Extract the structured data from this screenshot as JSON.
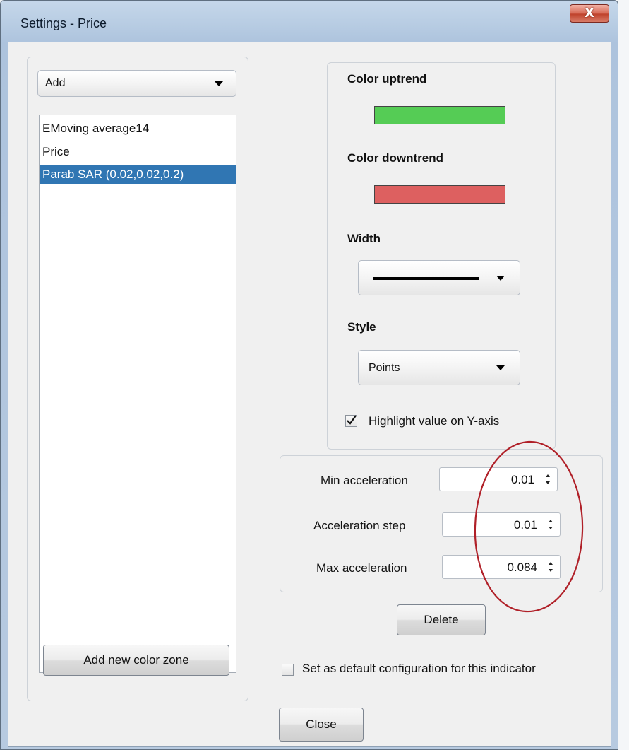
{
  "window": {
    "title": "Settings - Price",
    "close_glyph": "X"
  },
  "left_panel": {
    "add_dropdown": {
      "value": "Add"
    },
    "indicators": [
      {
        "label": "EMoving average14",
        "selected": false
      },
      {
        "label": "Price",
        "selected": false
      },
      {
        "label": "Parab SAR (0.02,0.02,0.2)",
        "selected": true
      }
    ],
    "add_zone_button": "Add new color zone"
  },
  "style_panel": {
    "color_uptrend_label": "Color uptrend",
    "color_uptrend": "#55cc55",
    "color_downtrend_label": "Color downtrend",
    "color_downtrend": "#dd6060",
    "width_label": "Width",
    "style_label": "Style",
    "style_value": "Points",
    "highlight_label": "Highlight value on Y-axis",
    "highlight_checked": true
  },
  "params": {
    "min_acceleration": {
      "label": "Min acceleration",
      "value": "0.01"
    },
    "acceleration_step": {
      "label": "Acceleration step",
      "value": "0.01"
    },
    "max_acceleration": {
      "label": "Max acceleration",
      "value": "0.084"
    }
  },
  "delete_button": "Delete",
  "default_config_label": "Set as default configuration for this indicator",
  "default_config_checked": false,
  "close_button": "Close",
  "annotation_color": "#b02028"
}
